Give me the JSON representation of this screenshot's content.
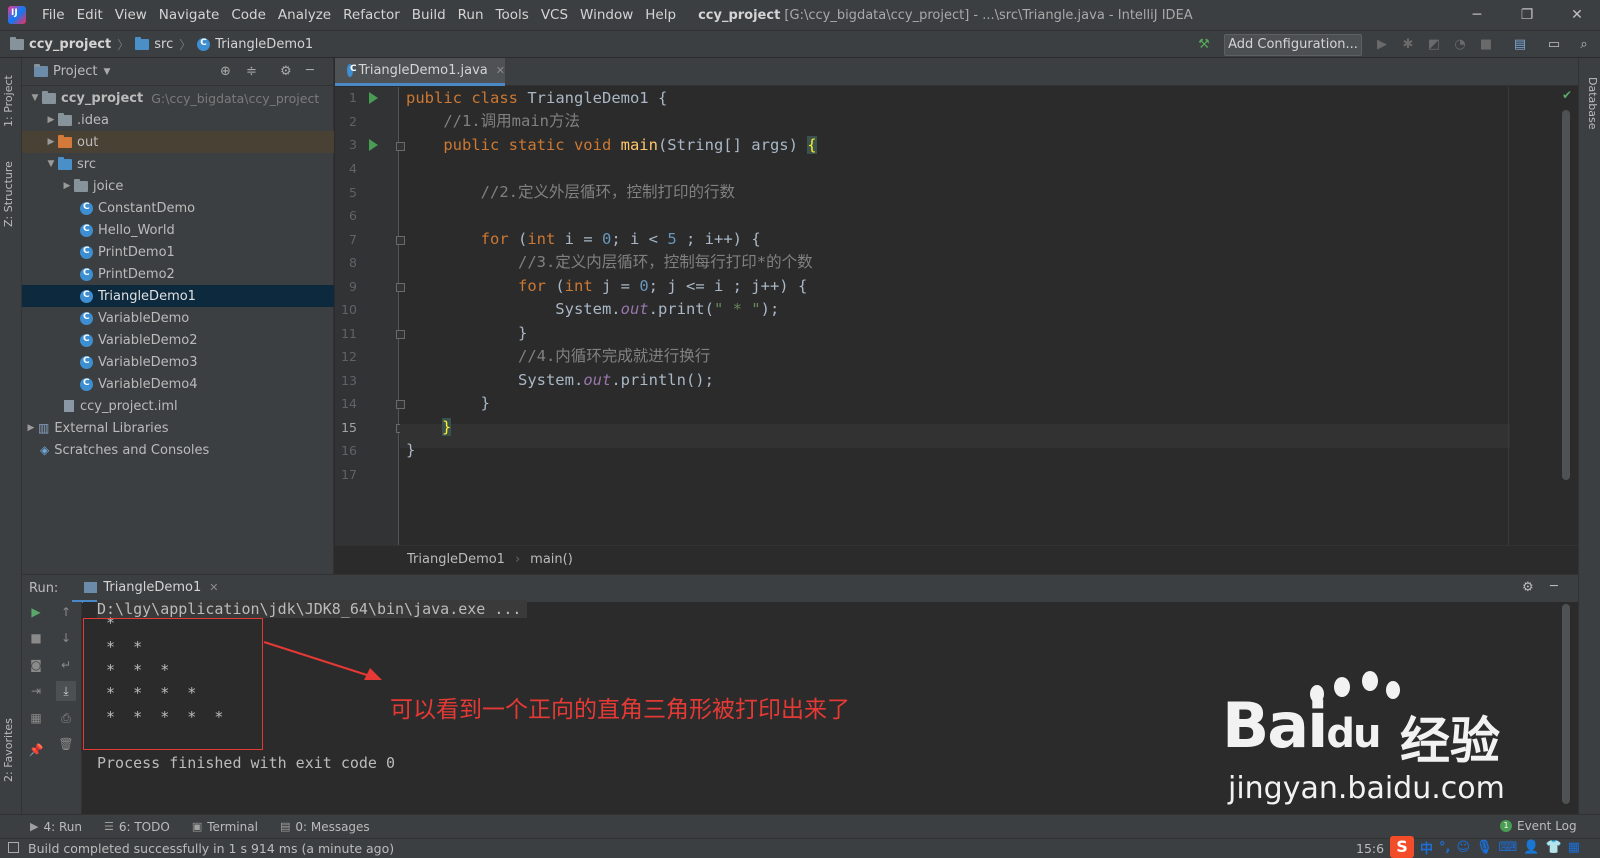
{
  "menu": {
    "items": [
      "File",
      "Edit",
      "View",
      "Navigate",
      "Code",
      "Analyze",
      "Refactor",
      "Build",
      "Run",
      "Tools",
      "VCS",
      "Window",
      "Help"
    ],
    "window_title_project": "ccy_project",
    "window_title_rest": " [G:\\ccy_bigdata\\ccy_project] - ...\\src\\Triangle.java - IntelliJ IDEA"
  },
  "navbar": {
    "crumbs": [
      "ccy_project",
      "src",
      "TriangleDemo1"
    ],
    "add_config_label": "Add Configuration..."
  },
  "side_tabs": {
    "project": "1: Project",
    "structure": "Z: Structure",
    "favorites": "2: Favorites",
    "database": "Database"
  },
  "project_panel": {
    "title": "Project",
    "root_name": "ccy_project",
    "root_path": "G:\\ccy_bigdata\\ccy_project",
    "tree": [
      {
        "label": ".idea",
        "type": "folder"
      },
      {
        "label": "out",
        "type": "folder-orange"
      },
      {
        "label": "src",
        "type": "folder-blue"
      },
      {
        "label": "joice",
        "type": "package"
      },
      {
        "label": "ConstantDemo",
        "type": "class"
      },
      {
        "label": "Hello_World",
        "type": "class"
      },
      {
        "label": "PrintDemo1",
        "type": "class"
      },
      {
        "label": "PrintDemo2",
        "type": "class"
      },
      {
        "label": "TriangleDemo1",
        "type": "class",
        "selected": true
      },
      {
        "label": "VariableDemo",
        "type": "class"
      },
      {
        "label": "VariableDemo2",
        "type": "class"
      },
      {
        "label": "VariableDemo3",
        "type": "class"
      },
      {
        "label": "VariableDemo4",
        "type": "class"
      },
      {
        "label": "ccy_project.iml",
        "type": "file"
      },
      {
        "label": "External Libraries",
        "type": "library"
      },
      {
        "label": "Scratches and Consoles",
        "type": "scratch"
      }
    ]
  },
  "editor": {
    "tab_label": "TriangleDemo1.java",
    "line_numbers": [
      "1",
      "2",
      "3",
      "4",
      "5",
      "6",
      "7",
      "8",
      "9",
      "10",
      "11",
      "12",
      "13",
      "14",
      "15",
      "16",
      "17"
    ],
    "current_line": "15",
    "breadcrumb_class": "TriangleDemo1",
    "breadcrumb_method": "main()",
    "code": {
      "l1_kw": "public class ",
      "l1_name": "TriangleDemo1 {",
      "l2": "    //1.调用main方法",
      "l3_kw": "    public static void ",
      "l3_fn": "main",
      "l3_rest": "(String[] args) ",
      "l3_brace": "{",
      "l5": "        //2.定义外层循环，控制打印的行数",
      "l7_kw1": "        for ",
      "l7_a": "(",
      "l7_kw2": "int ",
      "l7_b": "i = ",
      "l7_n1": "0",
      "l7_c": "; i < ",
      "l7_n2": "5",
      "l7_d": " ; i++) {",
      "l8": "            //3.定义内层循环，控制每行打印*的个数",
      "l9_kw1": "            for ",
      "l9_a": "(",
      "l9_kw2": "int ",
      "l9_b": "j = ",
      "l9_n1": "0",
      "l9_c": "; j <= i ; j++) {",
      "l10_a": "                System.",
      "l10_fld": "out",
      "l10_b": ".print(",
      "l10_str": "\" * \"",
      "l10_c": ");",
      "l11": "            }",
      "l12": "            //4.内循环完成就进行换行",
      "l13_a": "            System.",
      "l13_fld": "out",
      "l13_b": ".println();",
      "l14": "        }",
      "l15": "}",
      "l16": "}"
    }
  },
  "run_panel": {
    "label": "Run:",
    "tab_label": "TriangleDemo1",
    "console_lines": [
      "D:\\lgy\\application\\jdk\\JDK8_64\\bin\\java.exe ...",
      " *",
      " *  *",
      " *  *  *",
      " *  *  *  *",
      " *  *  *  *  *",
      "",
      "Process finished with exit code 0"
    ],
    "annotation": "可以看到一个正向的直角三角形被打印出来了"
  },
  "watermark": {
    "logo": "Bai",
    "logo_du": "du",
    "cn": "经验",
    "url": "jingyan.baidu.com"
  },
  "bottom_tabs": [
    "4: Run",
    "6: TODO",
    "Terminal",
    "0: Messages"
  ],
  "event_log": "Event Log",
  "status": {
    "message": "Build completed successfully in 1 s 914 ms (a minute ago)",
    "position": "15:6"
  },
  "ime": {
    "brand": "S",
    "lang": "中"
  },
  "colors": {
    "accent": "#4a88c7",
    "annotation_red": "#e53935",
    "keyword": "#cc7832",
    "comment": "#808080",
    "number": "#6897bb",
    "string": "#6a8759",
    "method": "#ffc66d"
  }
}
